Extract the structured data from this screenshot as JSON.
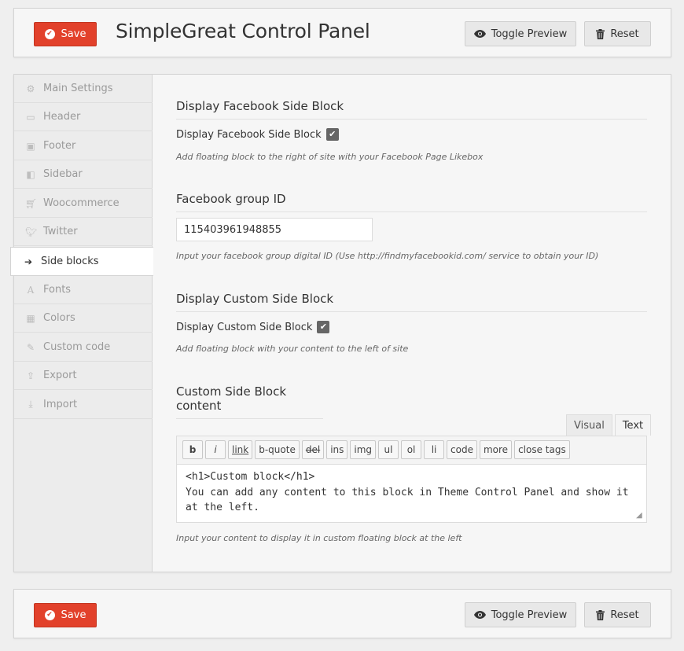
{
  "header": {
    "save_label": "Save",
    "title": "SimpleGreat Control Panel",
    "toggle_preview_label": "Toggle Preview",
    "reset_label": "Reset"
  },
  "footer": {
    "save_label": "Save",
    "toggle_preview_label": "Toggle Preview",
    "reset_label": "Reset"
  },
  "sidebar": {
    "items": [
      {
        "label": "Main Settings",
        "icon": "gear-icon"
      },
      {
        "label": "Header",
        "icon": "monitor-icon"
      },
      {
        "label": "Footer",
        "icon": "footer-icon"
      },
      {
        "label": "Sidebar",
        "icon": "columns-icon"
      },
      {
        "label": "Woocommerce",
        "icon": "cart-icon"
      },
      {
        "label": "Twitter",
        "icon": "twitter-icon"
      },
      {
        "label": "Side blocks",
        "icon": "sign-in-icon",
        "active": true
      },
      {
        "label": "Fonts",
        "icon": "font-icon"
      },
      {
        "label": "Colors",
        "icon": "calendar-icon"
      },
      {
        "label": "Custom code",
        "icon": "edit-icon"
      },
      {
        "label": "Export",
        "icon": "upload-icon"
      },
      {
        "label": "Import",
        "icon": "download-icon"
      }
    ]
  },
  "content": {
    "fb_section_title": "Display Facebook Side Block",
    "fb_checkbox_label": "Display Facebook Side Block",
    "fb_checked": true,
    "fb_desc": "Add floating block to the right of site with your Facebook Page Likebox",
    "group_title": "Facebook group ID",
    "group_value": "115403961948855",
    "group_desc": "Input your facebook group digital ID (Use http://findmyfacebookid.com/ service to obtain your ID)",
    "custom_section_title": "Display Custom Side Block",
    "custom_checkbox_label": "Display Custom Side Block",
    "custom_checked": true,
    "custom_desc": "Add floating block with your content to the left of site",
    "content_title": "Custom Side Block content",
    "editor_tabs": [
      "Visual",
      "Text"
    ],
    "active_tab": "Text",
    "toolbar": [
      "b",
      "i",
      "link",
      "b-quote",
      "del",
      "ins",
      "img",
      "ul",
      "ol",
      "li",
      "code",
      "more",
      "close tags"
    ],
    "editor_value": "<h1>Custom block</h1>\nYou can add any content to this block in Theme Control Panel and show it at the left.",
    "content_desc": "Input your content to display it in custom floating block at the left"
  },
  "colors": {
    "save_red": "#e2412b",
    "background": "#efefef"
  }
}
